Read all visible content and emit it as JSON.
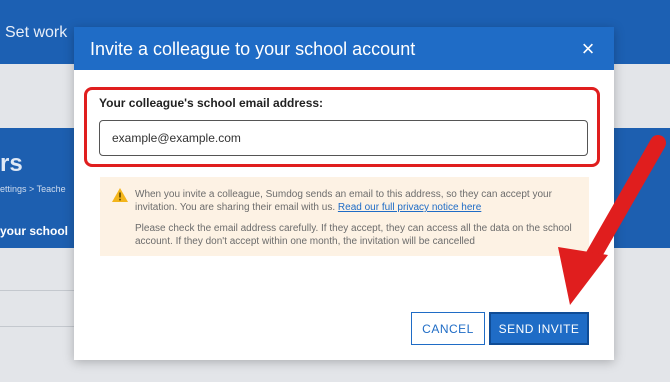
{
  "background": {
    "nav_label": "Set work",
    "page_title": "rs",
    "breadcrumb": "ettings > Teache",
    "section_label": "your school"
  },
  "dialog": {
    "title": "Invite a colleague to your school account",
    "close_icon": "×",
    "email_label": "Your colleague's school email address:",
    "email_value": "example@example.com",
    "notice": {
      "p1_text": "When you invite a colleague, Sumdog sends an email to this address, so they can accept your invitation. You are sharing their email with us.",
      "p1_link": "Read our full privacy notice here",
      "p2_text": "Please check the email address carefully. If they accept, they can access all the data on the school account. If they don't accept within one month, the invitation will be cancelled"
    },
    "cancel_label": "CANCEL",
    "send_label": "SEND INVITE"
  },
  "colors": {
    "header_blue": "#1f6cc6",
    "highlight_red": "#e01e1e",
    "notice_bg": "#fdf2e4",
    "warning_yellow": "#f3b51b"
  }
}
